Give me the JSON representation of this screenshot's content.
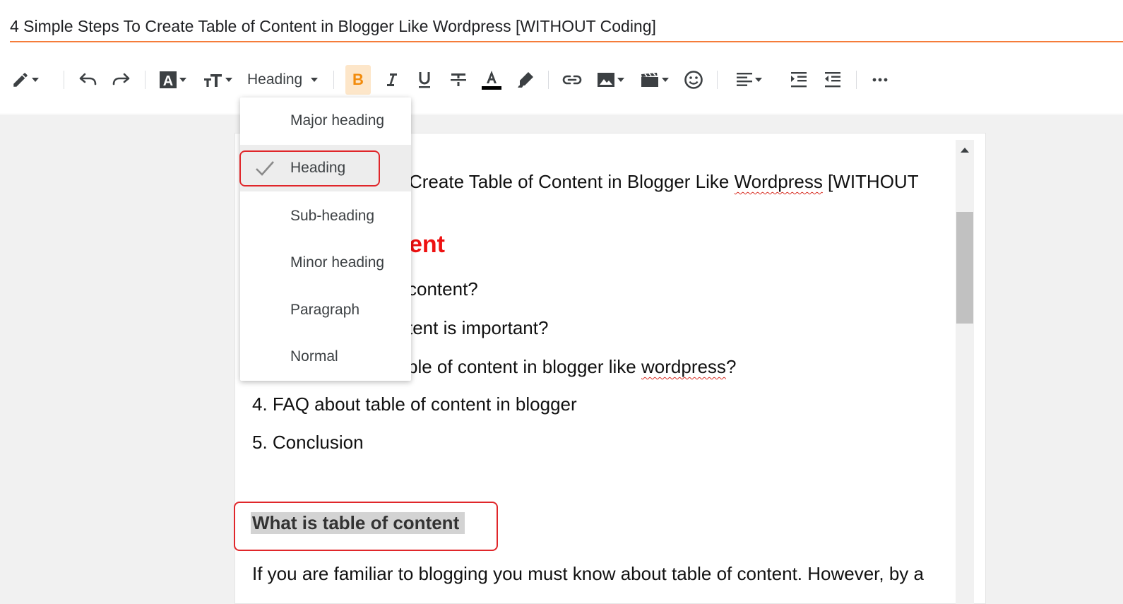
{
  "post": {
    "title": "4 Simple Steps To Create Table of Content in Blogger Like Wordpress [WITHOUT Coding]"
  },
  "toolbar": {
    "heading_select_label": "Heading",
    "buttons": [
      {
        "name": "pencil-icon"
      },
      {
        "name": "undo-icon"
      },
      {
        "name": "redo-icon"
      },
      {
        "name": "font-icon"
      },
      {
        "name": "font-size-icon"
      },
      {
        "name": "bold-icon"
      },
      {
        "name": "italic-icon"
      },
      {
        "name": "underline-icon"
      },
      {
        "name": "strikethrough-icon"
      },
      {
        "name": "text-color-icon"
      },
      {
        "name": "highlight-icon"
      },
      {
        "name": "link-icon"
      },
      {
        "name": "image-icon"
      },
      {
        "name": "video-icon"
      },
      {
        "name": "emoji-icon"
      },
      {
        "name": "align-icon"
      },
      {
        "name": "indent-increase-icon"
      },
      {
        "name": "indent-decrease-icon"
      },
      {
        "name": "more-icon"
      }
    ],
    "bold_label": "B"
  },
  "heading_menu": {
    "items": [
      {
        "label": "Major heading",
        "selected": false
      },
      {
        "label": "Heading",
        "selected": true
      },
      {
        "label": "Sub-heading",
        "selected": false
      },
      {
        "label": "Minor heading",
        "selected": false
      },
      {
        "label": "Paragraph",
        "selected": false
      },
      {
        "label": "Normal",
        "selected": false
      }
    ]
  },
  "document": {
    "line1_visible": "Create Table of Content in Blogger Like ",
    "line1_misspelled": "Wordpress",
    "line1_end": " [WITHOUT",
    "toc_title_visible": "ent",
    "item1_visible": "content?",
    "item2_visible": "tent is important?",
    "item3_visible": "ble of content in blogger like ",
    "item3_misspelled": "wordpress",
    "item3_end": "?",
    "item4": "4. FAQ about table of content in blogger",
    "item5": "5. Conclusion",
    "heading2": "What is table of content",
    "paragraph": "If you are familiar to blogging you must know about table of content. However, by a"
  },
  "colors": {
    "accent_underline": "#f57c3a",
    "toc_title": "#ee1111",
    "highlight_box": "#e0262a",
    "bold_button_bg": "#fde6c9",
    "bold_letter": "#f28b0c"
  }
}
